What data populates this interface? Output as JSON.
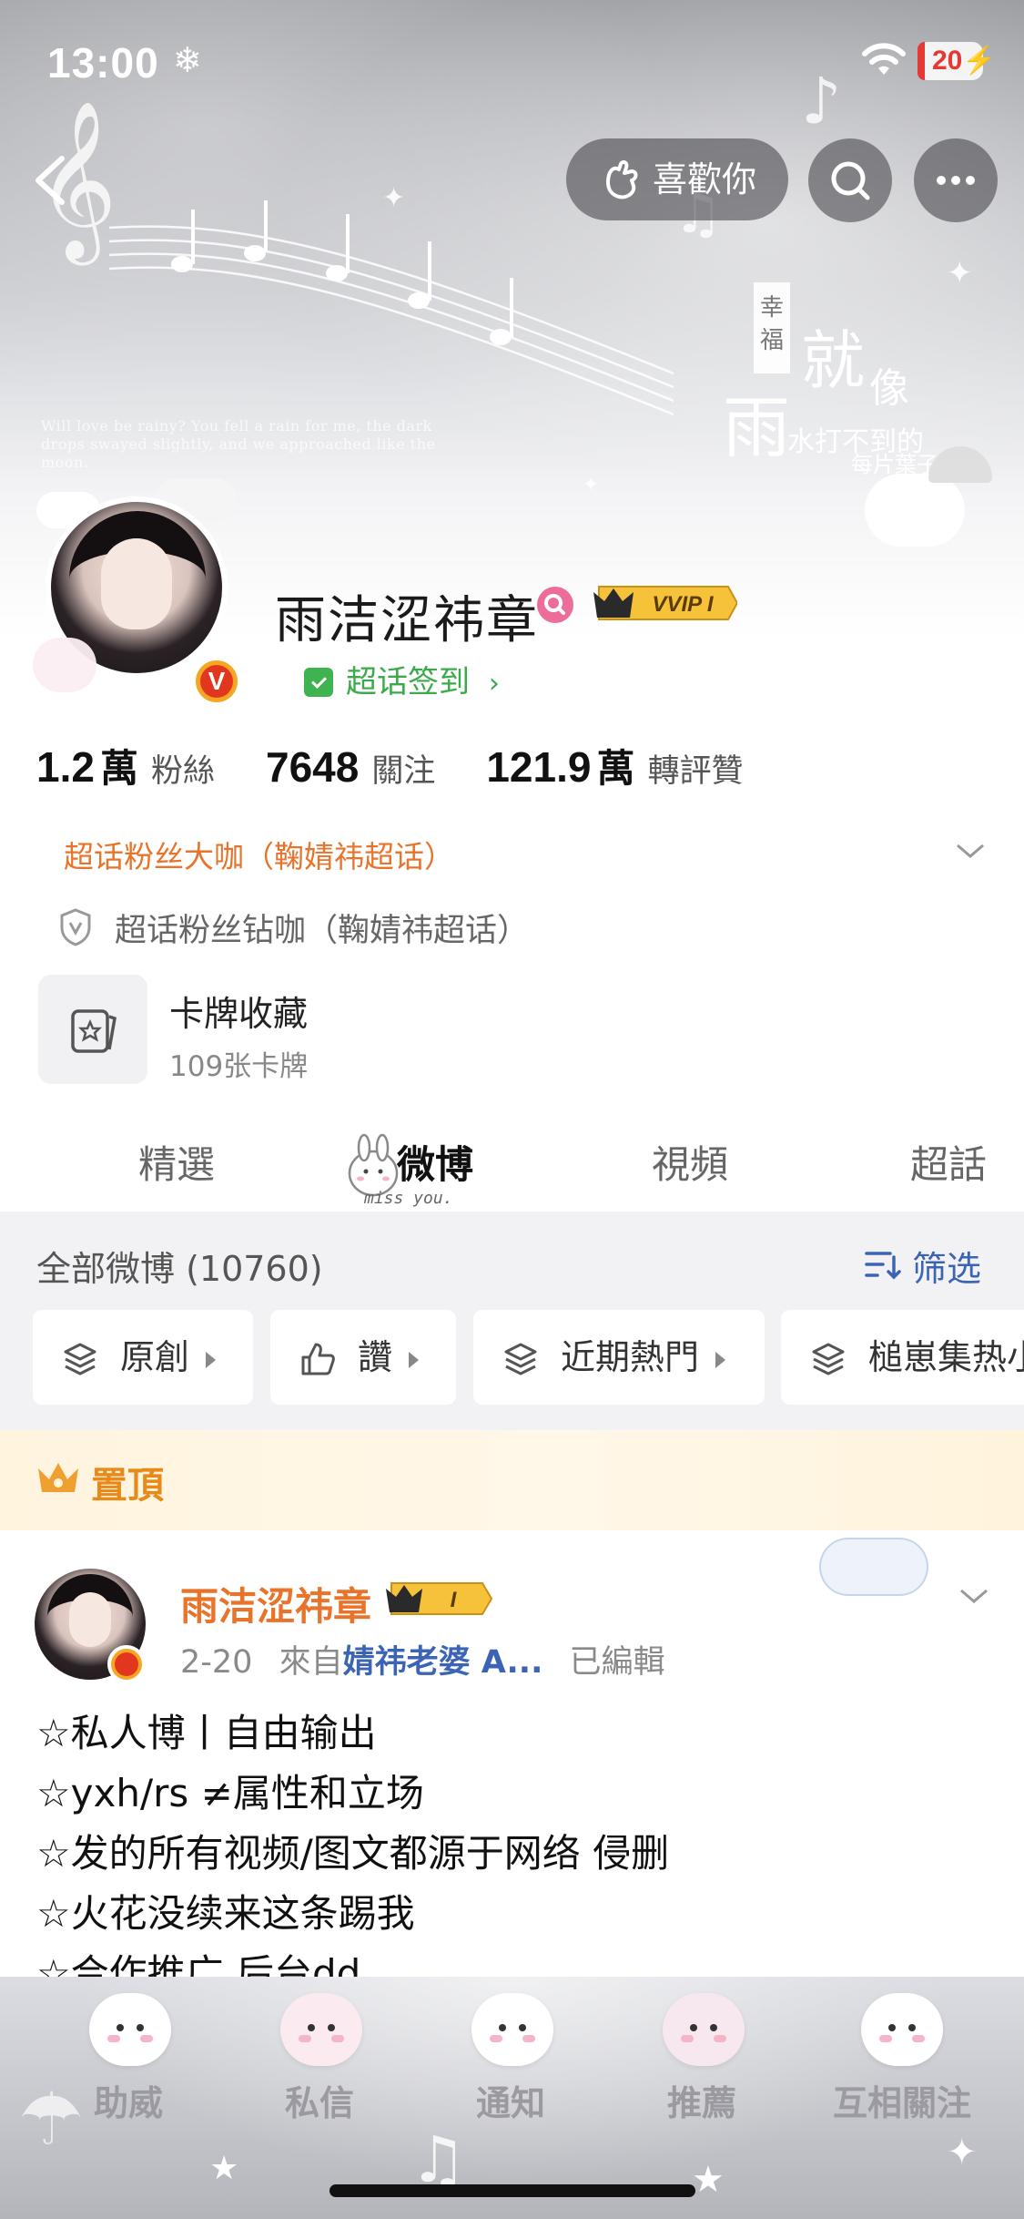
{
  "status_bar": {
    "time": "13:00",
    "battery": "20"
  },
  "header": {
    "like_label": "喜歡你",
    "banner_quote": "Will love be rainy? You fell a rain for me, the dark drops swayed slightly, and we approached like the moon.",
    "banner_tag": "幸福",
    "banner_big": [
      "雨",
      "就",
      "像"
    ],
    "banner_small": "水打不到的",
    "banner_small2": "每片葉子"
  },
  "profile": {
    "username": "雨洁涩祎章",
    "vip_label": "VVIP I",
    "chaohua_label": "超话签到",
    "stats": [
      {
        "value": "1.2",
        "unit": "萬",
        "label": "粉絲"
      },
      {
        "value": "7648",
        "unit": "",
        "label": "關注"
      },
      {
        "value": "121.9",
        "unit": "萬",
        "label": "轉評贊"
      }
    ],
    "fan_tag": "超话粉丝大咖（鞠婧祎超话）",
    "fan_tag2": "超话粉丝钻咖（鞠婧祎超话）",
    "card_title": "卡牌收藏",
    "card_sub": "109张卡牌"
  },
  "tabs": [
    {
      "label": "精選",
      "active": false
    },
    {
      "label": "微博",
      "active": true
    },
    {
      "label": "視頻",
      "active": false
    },
    {
      "label": "超話",
      "active": false
    }
  ],
  "tab_deco_text": "miss you.",
  "feed": {
    "all_label": "全部微博 (10760)",
    "filter_label": "筛选",
    "chips": [
      "原創",
      "讚",
      "近期熱門",
      "槌崽集热小"
    ],
    "pin_label": "置頂"
  },
  "post": {
    "author": "雨洁涩祎章",
    "badge": "I",
    "date": "2-20",
    "from_prefix": "來自",
    "source": "婧祎老婆 A...",
    "edited": "已編輯",
    "lines": [
      "☆私人博丨自由输出",
      "☆yxh/rs ≠属性和立场",
      "☆发的所有视频/图文都源于网络 侵删",
      "☆火花没续来这条踢我",
      "☆合作推广 后台dd"
    ]
  },
  "bottom_nav": [
    "助威",
    "私信",
    "通知",
    "推薦",
    "互相關注"
  ],
  "colors": {
    "accent_orange": "#e8732a",
    "link_blue": "#3c64b4",
    "green": "#3aaa4a",
    "gold": "#f5a623"
  }
}
